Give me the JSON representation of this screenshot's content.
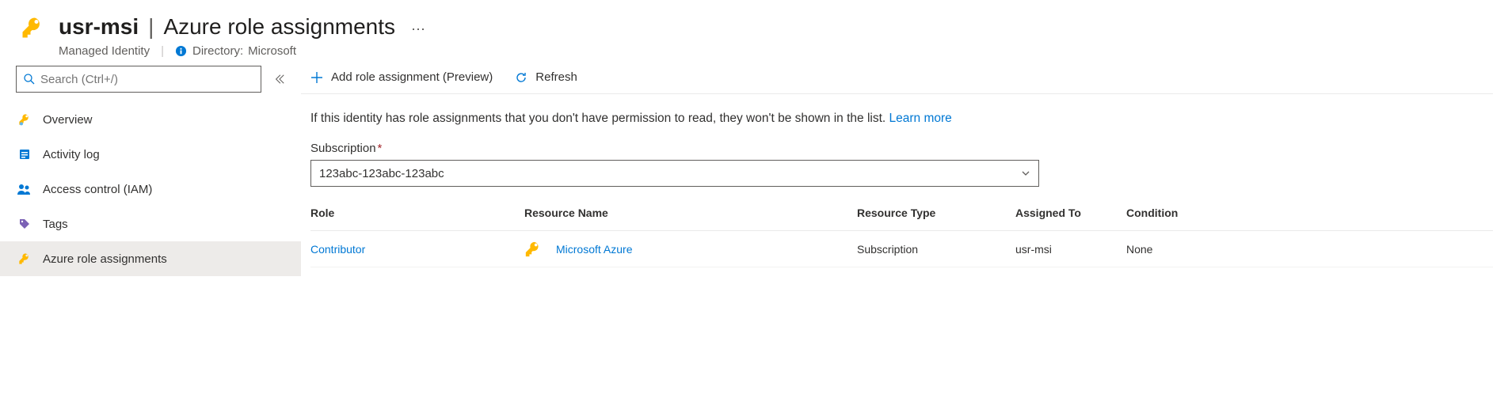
{
  "header": {
    "resource_name": "usr-msi",
    "page_title": "Azure role assignments",
    "resource_type": "Managed Identity",
    "directory_label": "Directory:",
    "directory_value": "Microsoft"
  },
  "sidebar": {
    "search_placeholder": "Search (Ctrl+/)",
    "items": [
      {
        "label": "Overview"
      },
      {
        "label": "Activity log"
      },
      {
        "label": "Access control (IAM)"
      },
      {
        "label": "Tags"
      },
      {
        "label": "Azure role assignments"
      }
    ]
  },
  "toolbar": {
    "add": "Add role assignment (Preview)",
    "refresh": "Refresh"
  },
  "notice": {
    "text": "If this identity has role assignments that you don't have permission to read, they won't be shown in the list. ",
    "learn_more": "Learn more"
  },
  "subscription": {
    "label": "Subscription",
    "value": "123abc-123abc-123abc"
  },
  "table": {
    "headers": {
      "role": "Role",
      "resource_name": "Resource Name",
      "resource_type": "Resource Type",
      "assigned_to": "Assigned To",
      "condition": "Condition"
    },
    "rows": [
      {
        "role": "Contributor",
        "resource_name": "Microsoft Azure",
        "resource_type": "Subscription",
        "assigned_to": "usr-msi",
        "condition": "None"
      }
    ]
  }
}
